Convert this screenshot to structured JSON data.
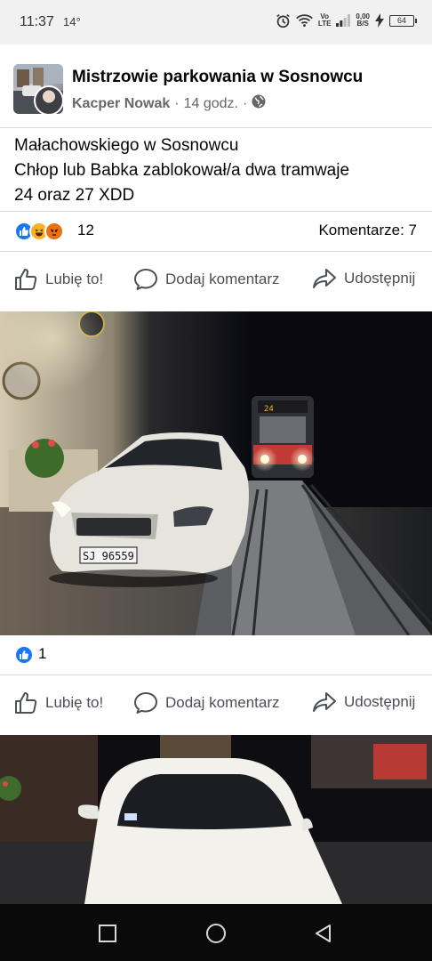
{
  "status_bar": {
    "time": "11:37",
    "temperature": "14°",
    "speed_value": "0,00",
    "speed_unit": "B/S",
    "volte_top": "Vo",
    "volte_bottom": "LTE",
    "battery": "64"
  },
  "post": {
    "group_name": "Mistrzowie parkowania w Sosnowcu",
    "author": "Kacper Nowak",
    "separator": "·",
    "time": "14 godz.",
    "text_lines": [
      "Małachowskiego w Sosnowcu",
      "Chłop lub Babka zablokował/a dwa tramwaje",
      "24 oraz 27 XDD"
    ],
    "reactions_count": "12",
    "comments_label": "Komentarze: 7",
    "reaction_icons": [
      "like-icon",
      "haha-icon",
      "angry-icon"
    ]
  },
  "actions": {
    "like": "Lubię to!",
    "comment": "Dodaj komentarz",
    "share": "Udostępnij"
  },
  "photo1": {
    "reactions_count": "1",
    "plate": "SJ 96559",
    "tram_number": "24"
  },
  "colors": {
    "facebook_blue": "#1877f2",
    "text_primary": "#050505",
    "text_secondary": "#65676b",
    "status_bar_bg": "#f1f1f1"
  }
}
